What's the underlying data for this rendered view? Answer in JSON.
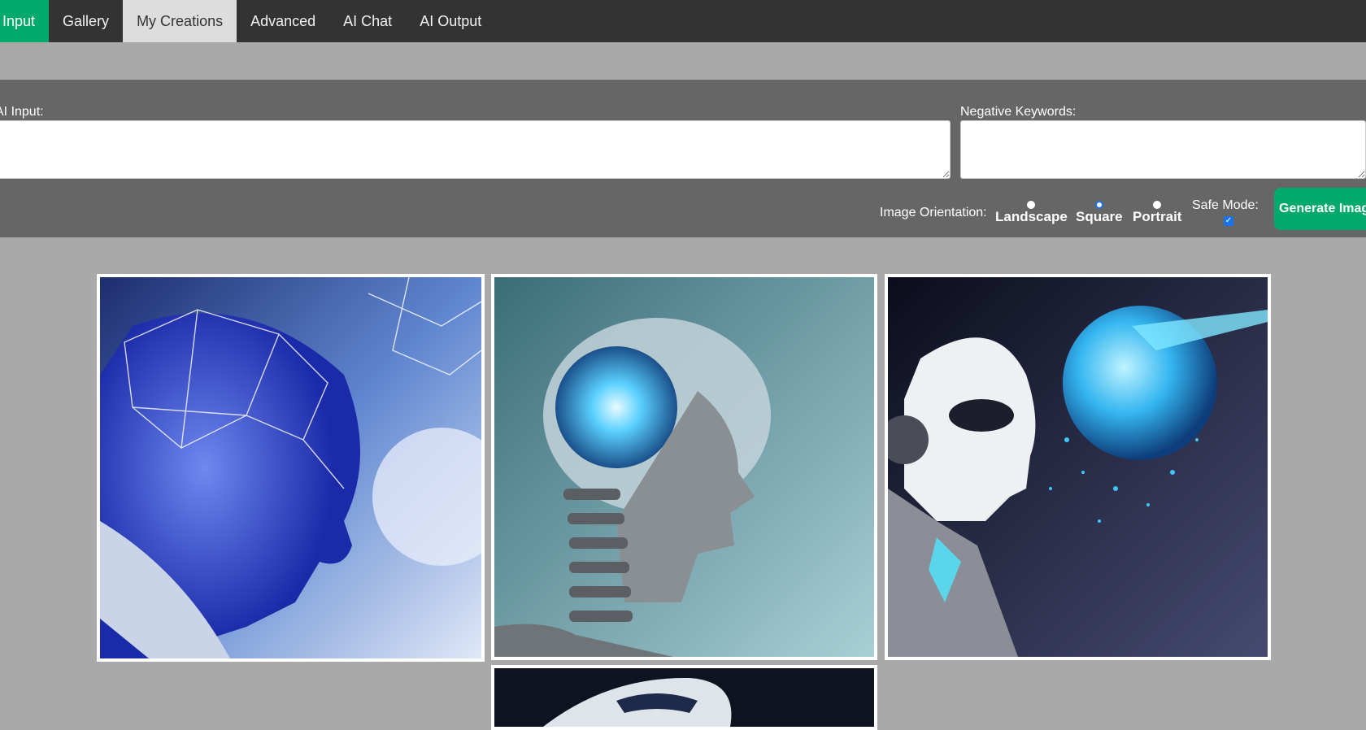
{
  "nav": {
    "tabs": [
      {
        "label": "Input"
      },
      {
        "label": "Gallery"
      },
      {
        "label": "My Creations"
      },
      {
        "label": "Advanced"
      },
      {
        "label": "AI Chat"
      },
      {
        "label": "AI Output"
      }
    ]
  },
  "form": {
    "ai_input_label": "AI Input:",
    "ai_input_value": "",
    "negative_label": "Negative Keywords:",
    "negative_value": "",
    "orientation_label": "Image Orientation:",
    "orientation_options": [
      "Landscape",
      "Square",
      "Portrait"
    ],
    "orientation_selected": "Square",
    "safe_mode_label": "Safe Mode:",
    "safe_mode_checked": true,
    "generate_label": "Generate Image"
  },
  "gallery": {
    "images": [
      {
        "icon": "neural-network-robot-head-image"
      },
      {
        "icon": "glowing-brain-robot-head-image"
      },
      {
        "icon": "white-android-face-sphere-image"
      },
      {
        "icon": "robot-head-image"
      }
    ]
  },
  "colors": {
    "nav_bg": "#333333",
    "accent_green": "#04aa6d",
    "active_tab": "#dddddd",
    "panel_bg": "#666666",
    "page_bg": "#a9a9a9",
    "radio_selected": "#1a73e8"
  }
}
